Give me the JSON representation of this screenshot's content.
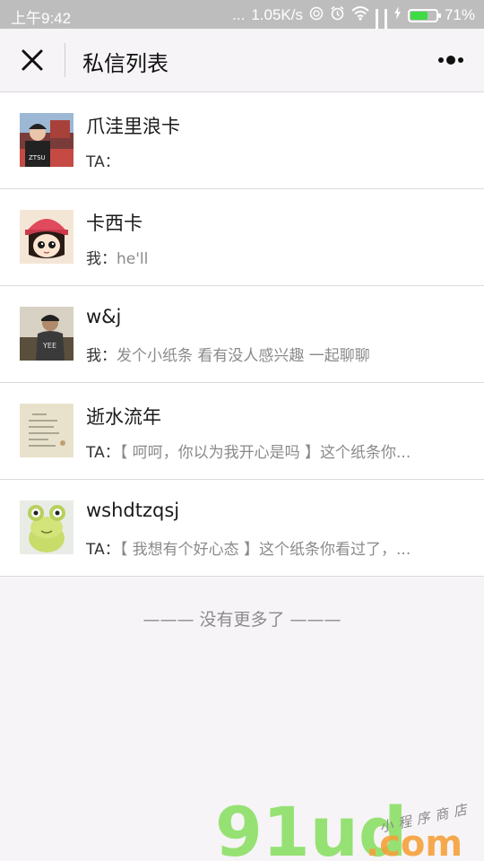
{
  "status_bar": {
    "time": "上午9:42",
    "dots": "...",
    "speed": "1.05K/s",
    "battery": "71%",
    "battery_level": 0.71
  },
  "header": {
    "title": "私信列表",
    "icons": [
      "close-icon",
      "more-icon"
    ]
  },
  "conversations": [
    {
      "name": "爪洼里浪卡",
      "who": "TA：",
      "message": ""
    },
    {
      "name": "卡西卡",
      "who": "我：",
      "message": "he'll"
    },
    {
      "name": "w&j",
      "who": "我：",
      "message": "发个小纸条 看有没人感兴趣 一起聊聊"
    },
    {
      "name": "逝水流年",
      "who": "TA：",
      "message": "【 呵呵，你以为我开心是吗 】这个纸条你..."
    },
    {
      "name": "wshdtzqsj",
      "who": "TA：",
      "message": "【 我想有个好心态 】这个纸条你看过了，..."
    }
  ],
  "footer": {
    "no_more": "——— 没有更多了 ———"
  },
  "watermark": {
    "brand": "91ud",
    "domain": ".com",
    "tagline": "小程序商店"
  },
  "colors": {
    "accent_green": "#3ddc44",
    "watermark_green": "#8ce066",
    "watermark_orange": "#f5a13a"
  }
}
